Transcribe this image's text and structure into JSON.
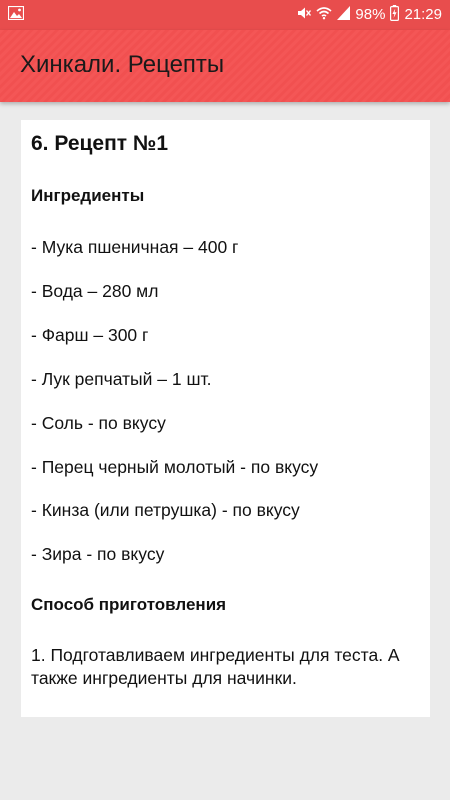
{
  "status_bar": {
    "battery_text": "98%",
    "time": "21:29"
  },
  "app_bar": {
    "title": "Хинкали. Рецепты"
  },
  "recipe": {
    "title": "6. Рецепт №1",
    "ingredients_heading": "Ингредиенты",
    "ingredients": [
      "- Мука пшеничная – 400 г",
      "- Вода – 280 мл",
      "- Фарш – 300 г",
      "- Лук репчатый – 1 шт.",
      "- Соль - по вкусу",
      "- Перец черный молотый - по вкусу",
      "- Кинза (или петрушка) - по вкусу",
      "- Зира - по вкусу"
    ],
    "method_heading": "Способ приготовления",
    "steps": [
      "1. Подготавливаем ингредиенты для теста. А также ингредиенты для начинки."
    ]
  },
  "colors": {
    "app_bar": "#f45656",
    "status_bar": "#e84d4d",
    "background": "#ebebeb",
    "card": "#ffffff"
  },
  "icons": [
    "image-icon",
    "mute-icon",
    "wifi-icon",
    "signal-icon",
    "battery-charging-icon"
  ]
}
